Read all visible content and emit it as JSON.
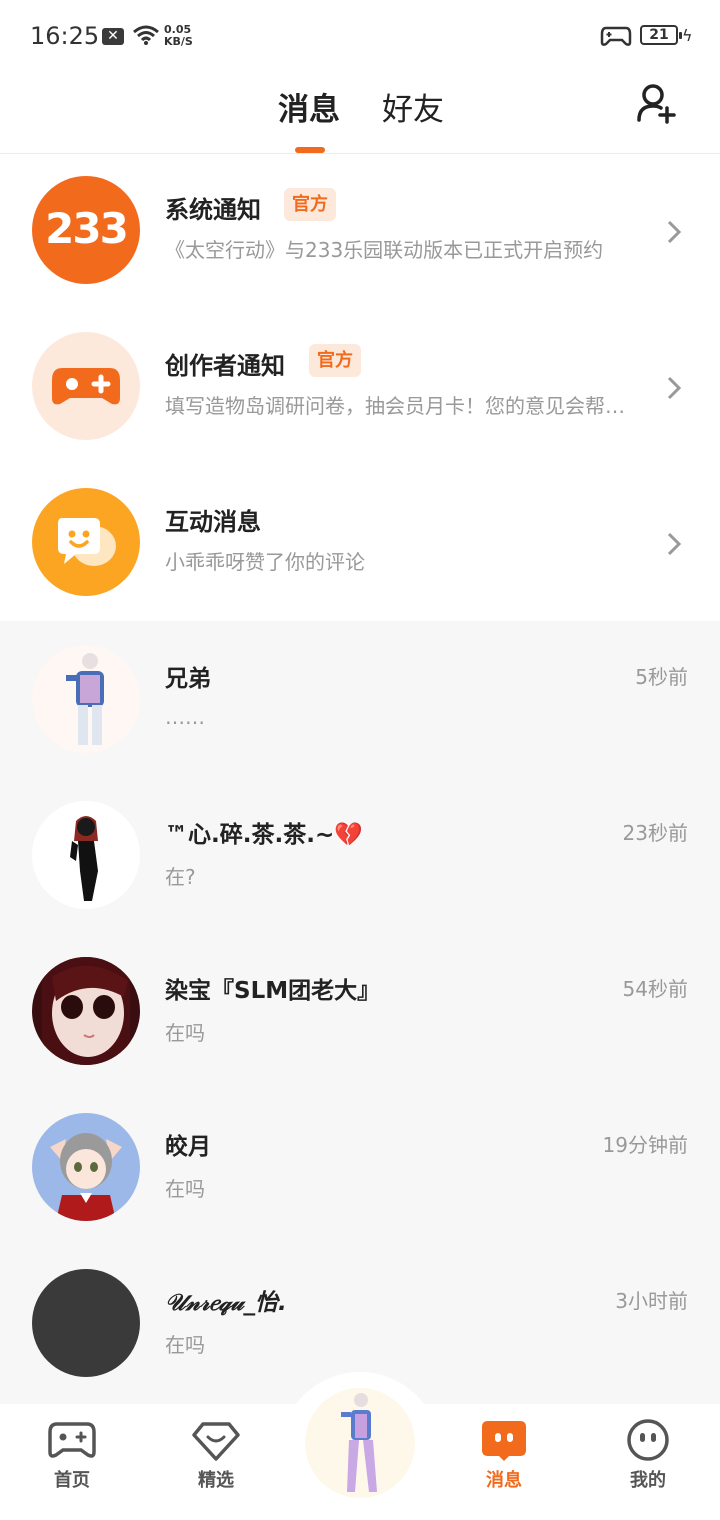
{
  "status_bar": {
    "time": "16:25",
    "speed_value": "0.05",
    "speed_unit": "KB/S",
    "battery": "21"
  },
  "header": {
    "tab_messages": "消息",
    "tab_friends": "好友"
  },
  "official": [
    {
      "title": "系统通知",
      "badge": "官方",
      "subtitle": "《太空行动》与233乐园联动版本已正式开启预约",
      "avatar_text": "233"
    },
    {
      "title": "创作者通知",
      "badge": "官方",
      "subtitle": "填写造物岛调研问卷，抽会员月卡！您的意见会帮助我们"
    },
    {
      "title": "互动消息",
      "subtitle": "小乖乖呀赞了你的评论"
    }
  ],
  "chats": [
    {
      "name": "兄弟",
      "message": "……",
      "time": "5秒前"
    },
    {
      "name": "™心.碎.茶.茶.~💔",
      "message": "在?",
      "time": "23秒前"
    },
    {
      "name": "染宝『SLM团老大』",
      "message": "在吗",
      "time": "54秒前"
    },
    {
      "name": "皎月",
      "message": "在吗",
      "time": "19分钟前"
    },
    {
      "name": "𝒰𝓃𝓇𝑒𝓆𝓊_怡.",
      "message": "在吗",
      "time": "3小时前"
    }
  ],
  "nav": {
    "home": "首页",
    "featured": "精选",
    "messages": "消息",
    "me": "我的"
  },
  "colors": {
    "accent": "#f26b1d",
    "accent_yellow": "#fca523"
  }
}
